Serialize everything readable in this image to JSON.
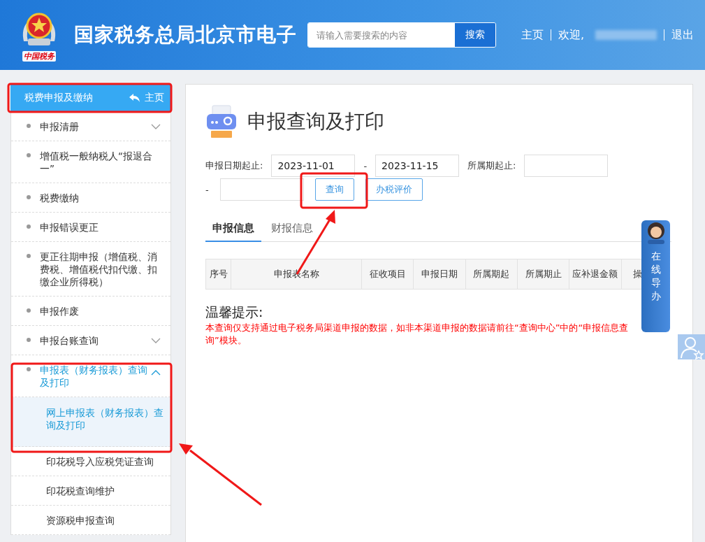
{
  "header": {
    "logo_caption": "中国税务",
    "title": "国家税务总局北京市电子",
    "search": {
      "placeholder": "请输入需要搜索的内容",
      "button": "搜索"
    },
    "nav": [
      {
        "kind": "link",
        "label": "主页"
      },
      {
        "kind": "welcome",
        "label": "欢迎,"
      },
      {
        "kind": "link",
        "label": "退出"
      }
    ]
  },
  "sidebar": {
    "title": "税费申报及缴纳",
    "home": "主页",
    "items": [
      {
        "label": "申报清册",
        "expandable": true,
        "expanded": false,
        "selected": false
      },
      {
        "label": "增值税一般纳税人“报退合一”",
        "expandable": false,
        "selected": false
      },
      {
        "label": "税费缴纳",
        "expandable": false,
        "selected": false
      },
      {
        "label": "申报错误更正",
        "expandable": false,
        "selected": false
      },
      {
        "label": "更正往期申报（增值税、消费税、增值税代扣代缴、扣缴企业所得税）",
        "expandable": false,
        "selected": false
      },
      {
        "label": "申报作废",
        "expandable": false,
        "selected": false
      },
      {
        "label": "申报台账查询",
        "expandable": true,
        "expanded": false,
        "selected": false
      },
      {
        "label": "申报表（财务报表）查询及打印",
        "expandable": true,
        "expanded": true,
        "selected": true,
        "children": [
          {
            "label": "网上申报表（财务报表）查询及打印",
            "selected": true
          },
          {
            "label": "印花税导入应税凭证查询",
            "selected": false
          },
          {
            "label": "印花税查询维护",
            "selected": false
          },
          {
            "label": "资源税申报查询",
            "selected": false
          }
        ]
      }
    ]
  },
  "page": {
    "title": "申报查询及打印",
    "filters": {
      "date_label": "申报日期起止:",
      "date_from": "2023-11-01",
      "date_sep": "-",
      "date_to": "2023-11-15",
      "period_label": "所属期起止:",
      "period_sep": "-"
    },
    "buttons": [
      "查询",
      "办税评价"
    ],
    "tabs": [
      {
        "label": "申报信息",
        "selected": true
      },
      {
        "label": "财报信息",
        "selected": false
      }
    ],
    "table": {
      "columns": [
        "序号",
        "申报表名称",
        "征收项目",
        "申报日期",
        "所属期起",
        "所属期止",
        "应补退金额",
        "操"
      ]
    },
    "tip": {
      "title": "温馨提示:",
      "text": "本查询仅支持通过电子税务局渠道申报的数据，如非本渠道申报的数据请前往“查询中心”中的“申报信息查询”模块。"
    }
  },
  "guide": {
    "label": "在线导办"
  }
}
